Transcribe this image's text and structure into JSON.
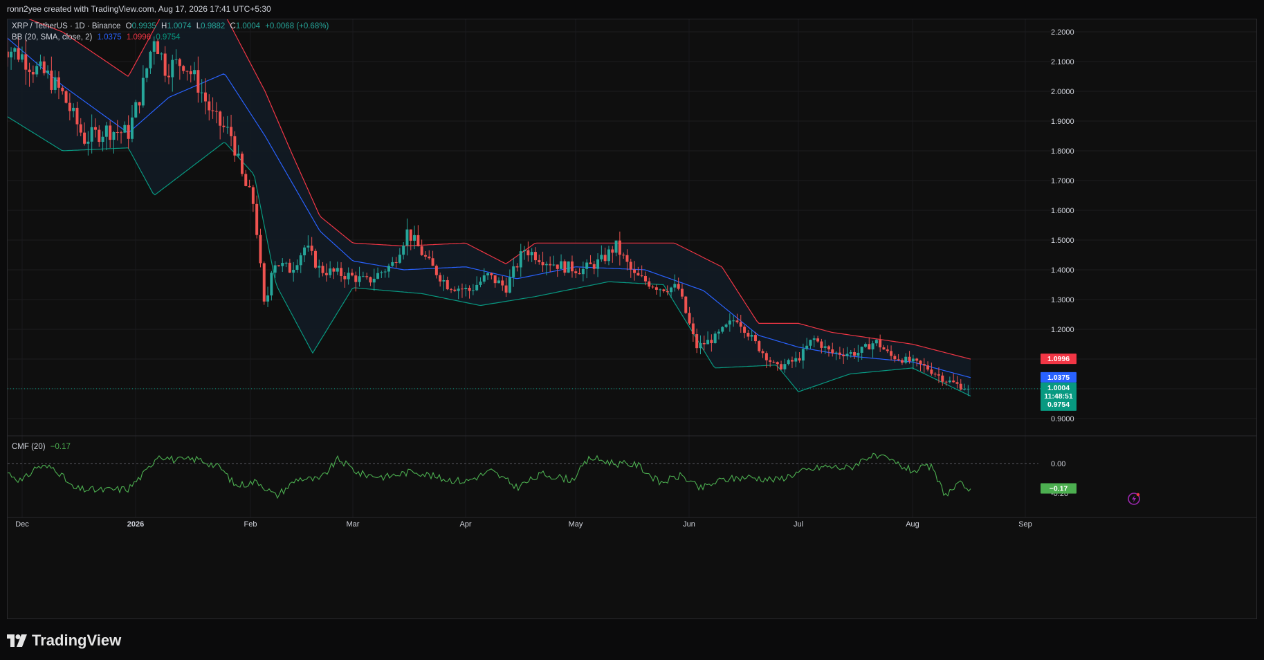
{
  "header": {
    "caption": "ronn2yee created with TradingView.com, Aug 17, 2026 17:41 UTC+5:30"
  },
  "legend": {
    "symbol": "XRP / TetherUS · 1D · Binance",
    "open_label": "O",
    "open": "0.9935",
    "high_label": "H",
    "high": "1.0074",
    "low_label": "L",
    "low": "0.9882",
    "close_label": "C",
    "close": "1.0004",
    "change": "+0.0068 (+0.68%)",
    "bb_label": "BB (20, SMA, close, 2)",
    "bb_basis": "1.0375",
    "bb_upper": "1.0996",
    "bb_lower": "0.9754"
  },
  "cmf_legend": {
    "label": "CMF (20)",
    "value": "−0.17"
  },
  "price_axis_ticks": [
    "2.2000",
    "2.1000",
    "2.0000",
    "1.9000",
    "1.8000",
    "1.7000",
    "1.6000",
    "1.5000",
    "1.4000",
    "1.3000",
    "1.2000",
    "0.9000"
  ],
  "cmf_axis_ticks": [
    "0.00",
    "-0.20"
  ],
  "price_labels": {
    "upper": "1.0996",
    "basis": "1.0375",
    "last": "1.0004",
    "countdown": "11:48:51",
    "lower": "0.9754",
    "cmf_last": "−0.17"
  },
  "time_axis": [
    "Dec",
    "2026",
    "Feb",
    "Mar",
    "Apr",
    "May",
    "Jun",
    "Jul",
    "Aug",
    "Sep"
  ],
  "colors": {
    "up": "#26a69a",
    "down": "#ef5350",
    "upper_band": "#f23645",
    "basis": "#2962ff",
    "lower_band": "#089981",
    "cmf": "#4caf50",
    "band_fill": "#121a24"
  },
  "footer": {
    "brand": "TradingView"
  },
  "chart_data": {
    "type": "candlestick",
    "title": "XRP / TetherUS · 1D · Binance",
    "x_range": [
      "Nov 2025",
      "Sep 2026"
    ],
    "ylim": [
      0.88,
      2.25
    ],
    "grid": true,
    "close_anchors": [
      {
        "x": "Nov 26",
        "y": 2.16
      },
      {
        "x": "Dec 1",
        "y": 2.12
      },
      {
        "x": "Dec 4",
        "y": 2.08
      },
      {
        "x": "Dec 8",
        "y": 2.05
      },
      {
        "x": "Dec 12",
        "y": 1.99
      },
      {
        "x": "Dec 18",
        "y": 1.84
      },
      {
        "x": "Dec 24",
        "y": 1.87
      },
      {
        "x": "Dec 30",
        "y": 1.86
      },
      {
        "x": "Jan 3",
        "y": 2.02
      },
      {
        "x": "Jan 6",
        "y": 2.19
      },
      {
        "x": "Jan 9",
        "y": 2.08
      },
      {
        "x": "Jan 14",
        "y": 2.1
      },
      {
        "x": "Jan 18",
        "y": 2.02
      },
      {
        "x": "Jan 22",
        "y": 1.91
      },
      {
        "x": "Jan 27",
        "y": 1.85
      },
      {
        "x": "Jan 30",
        "y": 1.7
      },
      {
        "x": "Feb 2",
        "y": 1.62
      },
      {
        "x": "Feb 5",
        "y": 1.25
      },
      {
        "x": "Feb 7",
        "y": 1.43
      },
      {
        "x": "Feb 12",
        "y": 1.4
      },
      {
        "x": "Feb 16",
        "y": 1.48
      },
      {
        "x": "Feb 20",
        "y": 1.4
      },
      {
        "x": "Feb 28",
        "y": 1.38
      },
      {
        "x": "Mar 5",
        "y": 1.36
      },
      {
        "x": "Mar 12",
        "y": 1.42
      },
      {
        "x": "Mar 16",
        "y": 1.53
      },
      {
        "x": "Mar 22",
        "y": 1.42
      },
      {
        "x": "Mar 27",
        "y": 1.35
      },
      {
        "x": "Apr 2",
        "y": 1.33
      },
      {
        "x": "Apr 7",
        "y": 1.38
      },
      {
        "x": "Apr 12",
        "y": 1.34
      },
      {
        "x": "Apr 17",
        "y": 1.47
      },
      {
        "x": "Apr 23",
        "y": 1.43
      },
      {
        "x": "Apr 28",
        "y": 1.41
      },
      {
        "x": "May 3",
        "y": 1.4
      },
      {
        "x": "May 8",
        "y": 1.43
      },
      {
        "x": "May 12",
        "y": 1.48
      },
      {
        "x": "May 17",
        "y": 1.38
      },
      {
        "x": "May 24",
        "y": 1.34
      },
      {
        "x": "May 29",
        "y": 1.34
      },
      {
        "x": "Jun 3",
        "y": 1.14
      },
      {
        "x": "Jun 8",
        "y": 1.17
      },
      {
        "x": "Jun 14",
        "y": 1.24
      },
      {
        "x": "Jun 20",
        "y": 1.14
      },
      {
        "x": "Jun 25",
        "y": 1.07
      },
      {
        "x": "Jul 1",
        "y": 1.1
      },
      {
        "x": "Jul 5",
        "y": 1.17
      },
      {
        "x": "Jul 10",
        "y": 1.12
      },
      {
        "x": "Jul 17",
        "y": 1.12
      },
      {
        "x": "Jul 22",
        "y": 1.16
      },
      {
        "x": "Jul 26",
        "y": 1.11
      },
      {
        "x": "Aug 1",
        "y": 1.09
      },
      {
        "x": "Aug 5",
        "y": 1.07
      },
      {
        "x": "Aug 10",
        "y": 1.03
      },
      {
        "x": "Aug 14",
        "y": 1.01
      },
      {
        "x": "Aug 17",
        "y": 1.0004
      }
    ],
    "bollinger": {
      "upper": [
        {
          "x": "Nov 26",
          "y": 2.28
        },
        {
          "x": "Dec 12",
          "y": 2.2
        },
        {
          "x": "Dec 30",
          "y": 2.05
        },
        {
          "x": "Jan 10",
          "y": 2.3
        },
        {
          "x": "Jan 25",
          "y": 2.26
        },
        {
          "x": "Feb 5",
          "y": 2.0
        },
        {
          "x": "Feb 12",
          "y": 1.8
        },
        {
          "x": "Feb 20",
          "y": 1.58
        },
        {
          "x": "Mar 1",
          "y": 1.49
        },
        {
          "x": "Mar 15",
          "y": 1.48
        },
        {
          "x": "Apr 1",
          "y": 1.49
        },
        {
          "x": "Apr 12",
          "y": 1.42
        },
        {
          "x": "Apr 20",
          "y": 1.49
        },
        {
          "x": "May 10",
          "y": 1.49
        },
        {
          "x": "May 28",
          "y": 1.49
        },
        {
          "x": "Jun 10",
          "y": 1.41
        },
        {
          "x": "Jun 20",
          "y": 1.22
        },
        {
          "x": "Jul 1",
          "y": 1.22
        },
        {
          "x": "Jul 10",
          "y": 1.19
        },
        {
          "x": "Aug 1",
          "y": 1.15
        },
        {
          "x": "Aug 17",
          "y": 1.0996
        }
      ],
      "basis": [
        {
          "x": "Nov 26",
          "y": 2.2
        },
        {
          "x": "Dec 12",
          "y": 2.02
        },
        {
          "x": "Dec 30",
          "y": 1.86
        },
        {
          "x": "Jan 10",
          "y": 1.98
        },
        {
          "x": "Jan 25",
          "y": 2.06
        },
        {
          "x": "Feb 5",
          "y": 1.85
        },
        {
          "x": "Feb 20",
          "y": 1.53
        },
        {
          "x": "Mar 1",
          "y": 1.43
        },
        {
          "x": "Mar 15",
          "y": 1.4
        },
        {
          "x": "Apr 1",
          "y": 1.41
        },
        {
          "x": "Apr 15",
          "y": 1.37
        },
        {
          "x": "May 1",
          "y": 1.41
        },
        {
          "x": "May 20",
          "y": 1.4
        },
        {
          "x": "Jun 5",
          "y": 1.33
        },
        {
          "x": "Jun 20",
          "y": 1.18
        },
        {
          "x": "Jul 1",
          "y": 1.14
        },
        {
          "x": "Jul 15",
          "y": 1.11
        },
        {
          "x": "Aug 1",
          "y": 1.09
        },
        {
          "x": "Aug 17",
          "y": 1.0375
        }
      ],
      "lower": [
        {
          "x": "Nov 26",
          "y": 1.93
        },
        {
          "x": "Dec 12",
          "y": 1.8
        },
        {
          "x": "Dec 30",
          "y": 1.81
        },
        {
          "x": "Jan 6",
          "y": 1.65
        },
        {
          "x": "Jan 25",
          "y": 1.83
        },
        {
          "x": "Feb 2",
          "y": 1.72
        },
        {
          "x": "Feb 8",
          "y": 1.35
        },
        {
          "x": "Feb 18",
          "y": 1.12
        },
        {
          "x": "Mar 1",
          "y": 1.34
        },
        {
          "x": "Mar 20",
          "y": 1.32
        },
        {
          "x": "Apr 5",
          "y": 1.28
        },
        {
          "x": "Apr 20",
          "y": 1.31
        },
        {
          "x": "May 10",
          "y": 1.36
        },
        {
          "x": "May 25",
          "y": 1.35
        },
        {
          "x": "Jun 8",
          "y": 1.07
        },
        {
          "x": "Jun 25",
          "y": 1.08
        },
        {
          "x": "Jul 1",
          "y": 0.99
        },
        {
          "x": "Jul 15",
          "y": 1.05
        },
        {
          "x": "Aug 1",
          "y": 1.07
        },
        {
          "x": "Aug 17",
          "y": 0.9754
        }
      ]
    },
    "cmf": {
      "name": "CMF (20)",
      "ylim": [
        -0.28,
        0.12
      ],
      "points": [
        {
          "x": "Nov 26",
          "y": -0.03
        },
        {
          "x": "Dec 1",
          "y": -0.12
        },
        {
          "x": "Dec 5",
          "y": -0.02
        },
        {
          "x": "Dec 10",
          "y": -0.03
        },
        {
          "x": "Dec 15",
          "y": -0.17
        },
        {
          "x": "Dec 22",
          "y": -0.18
        },
        {
          "x": "Dec 30",
          "y": -0.17
        },
        {
          "x": "Jan 4",
          "y": -0.05
        },
        {
          "x": "Jan 7",
          "y": 0.06
        },
        {
          "x": "Jan 12",
          "y": 0.02
        },
        {
          "x": "Jan 18",
          "y": 0.03
        },
        {
          "x": "Jan 24",
          "y": -0.03
        },
        {
          "x": "Jan 28",
          "y": -0.15
        },
        {
          "x": "Feb 3",
          "y": -0.12
        },
        {
          "x": "Feb 8",
          "y": -0.22
        },
        {
          "x": "Feb 14",
          "y": -0.1
        },
        {
          "x": "Feb 20",
          "y": -0.11
        },
        {
          "x": "Feb 25",
          "y": 0.03
        },
        {
          "x": "Mar 3",
          "y": -0.07
        },
        {
          "x": "Mar 10",
          "y": -0.09
        },
        {
          "x": "Mar 18",
          "y": -0.05
        },
        {
          "x": "Mar 25",
          "y": -0.1
        },
        {
          "x": "Apr 1",
          "y": -0.12
        },
        {
          "x": "Apr 8",
          "y": -0.05
        },
        {
          "x": "Apr 15",
          "y": -0.16
        },
        {
          "x": "Apr 22",
          "y": -0.07
        },
        {
          "x": "Apr 30",
          "y": -0.11
        },
        {
          "x": "May 5",
          "y": 0.04
        },
        {
          "x": "May 12",
          "y": 0.0
        },
        {
          "x": "May 18",
          "y": -0.01
        },
        {
          "x": "May 24",
          "y": -0.13
        },
        {
          "x": "May 30",
          "y": -0.08
        },
        {
          "x": "Jun 4",
          "y": -0.17
        },
        {
          "x": "Jun 10",
          "y": -0.11
        },
        {
          "x": "Jun 17",
          "y": -0.09
        },
        {
          "x": "Jun 25",
          "y": -0.11
        },
        {
          "x": "Jul 1",
          "y": -0.06
        },
        {
          "x": "Jul 8",
          "y": -0.02
        },
        {
          "x": "Jul 15",
          "y": -0.03
        },
        {
          "x": "Jul 20",
          "y": 0.05
        },
        {
          "x": "Jul 25",
          "y": 0.03
        },
        {
          "x": "Aug 1",
          "y": -0.05
        },
        {
          "x": "Aug 6",
          "y": -0.02
        },
        {
          "x": "Aug 10",
          "y": -0.21
        },
        {
          "x": "Aug 14",
          "y": -0.14
        },
        {
          "x": "Aug 17",
          "y": -0.17
        }
      ]
    }
  }
}
